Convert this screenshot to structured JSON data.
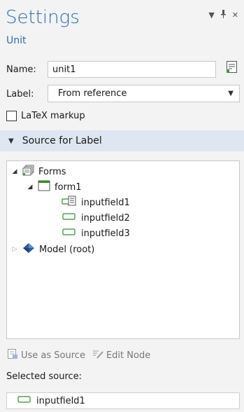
{
  "header": {
    "title": "Settings",
    "subtitle": "Unit",
    "controls": [
      "chevron-down-icon",
      "pin-icon",
      "close-icon"
    ]
  },
  "name_row": {
    "label": "Name:",
    "value": "unit1"
  },
  "label_row": {
    "label": "Label:",
    "selected": "From reference"
  },
  "latex": {
    "label": "LaTeX markup",
    "checked": false
  },
  "section": {
    "title": "Source for Label",
    "expanded": true
  },
  "tree": {
    "nodes": [
      {
        "label": "Forms",
        "expanded": true
      },
      {
        "label": "form1",
        "expanded": true
      },
      {
        "label": "inputfield1"
      },
      {
        "label": "inputfield2"
      },
      {
        "label": "inputfield3"
      },
      {
        "label": "Model (root)",
        "expanded": false
      }
    ]
  },
  "toolbar": {
    "use_as_source": "Use as Source",
    "edit_node": "Edit Node"
  },
  "selected_source": {
    "label": "Selected source:",
    "value": "inputfield1"
  },
  "colors": {
    "accent": "#2b6db5",
    "section_bg": "#dde6f1",
    "panel_bg": "#f3f3f3"
  }
}
